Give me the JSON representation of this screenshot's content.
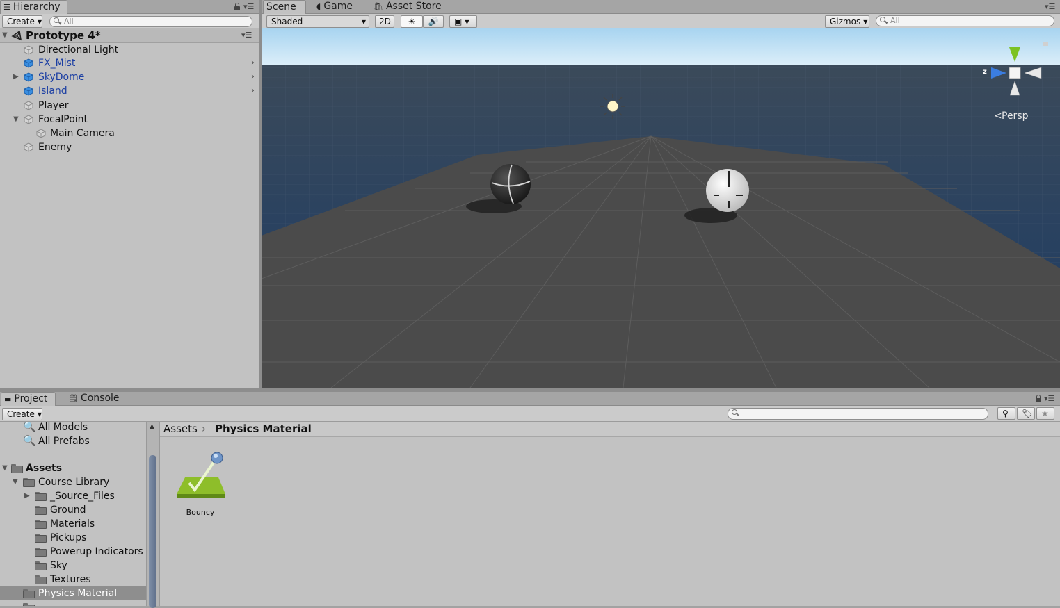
{
  "hierarchy": {
    "tab_label": "Hierarchy",
    "create_label": "Create",
    "search_placeholder": "All",
    "scene_name": "Prototype 4*",
    "items": [
      {
        "label": "Directional Light",
        "prefab": false
      },
      {
        "label": "FX_Mist",
        "prefab": true
      },
      {
        "label": "SkyDome",
        "prefab": true
      },
      {
        "label": "Island",
        "prefab": true
      },
      {
        "label": "Player",
        "prefab": false
      },
      {
        "label": "FocalPoint",
        "prefab": false
      },
      {
        "label": "Main Camera",
        "prefab": false
      },
      {
        "label": "Enemy",
        "prefab": false
      }
    ]
  },
  "scene_view": {
    "tabs": [
      "Scene",
      "Game",
      "Asset Store"
    ],
    "active_tab": "Scene",
    "shading_mode": "Shaded",
    "toggle_2d": "2D",
    "gizmos_label": "Gizmos",
    "search_placeholder": "All",
    "gizmo_axis_label": "z",
    "projection_label": "Persp"
  },
  "project": {
    "tabs": [
      "Project",
      "Console"
    ],
    "create_label": "Create",
    "favorites": [
      "All Models",
      "All Prefabs"
    ],
    "root_folder": "Assets",
    "folders": [
      {
        "label": "Course Library",
        "expanded": true
      },
      {
        "label": "_Source_Files",
        "expanded": false
      },
      {
        "label": "Ground"
      },
      {
        "label": "Materials"
      },
      {
        "label": "Pickups"
      },
      {
        "label": "Powerup Indicators"
      },
      {
        "label": "Sky"
      },
      {
        "label": "Textures"
      },
      {
        "label": "Physics Material",
        "selected": true
      }
    ],
    "breadcrumb": [
      "Assets",
      "Physics Material"
    ],
    "assets": [
      {
        "label": "Bouncy",
        "icon": "physics-material-icon"
      }
    ]
  },
  "colors": {
    "panel_bg": "#c2c2c2",
    "prefab_text": "#1c3fa3",
    "selection": "#8e8e8e",
    "ground": "#4b4b4b",
    "water": "#2a4260",
    "sky_top": "#a8d4f0",
    "gizmo_y": "#7cc223",
    "gizmo_z": "#3b7de0"
  }
}
